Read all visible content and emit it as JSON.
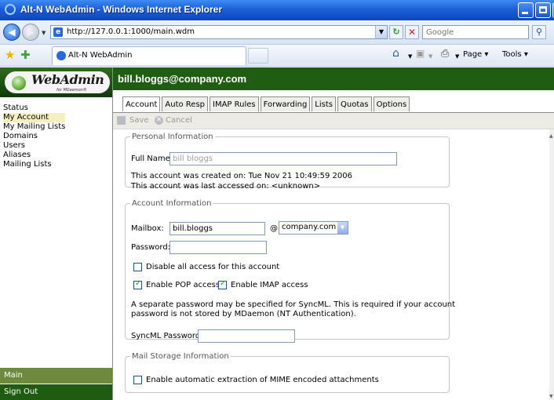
{
  "window": {
    "title": "Alt-N WebAdmin - Windows Internet Explorer"
  },
  "browser": {
    "url": "http://127.0.0.1:1000/main.wdm",
    "search_placeholder": "Google",
    "tab_label": "Alt-N WebAdmin",
    "page_menu": "Page ▾",
    "tools_menu": "Tools ▾"
  },
  "logo": {
    "brand": "WebAdmin",
    "sub": "for MDaemon®"
  },
  "sidebar": {
    "items": [
      "Status",
      "My Account",
      "My Mailing Lists",
      "Domains",
      "Users",
      "Aliases",
      "Mailing Lists"
    ],
    "active_index": 1,
    "main_label": "Main",
    "signout_label": "Sign Out"
  },
  "header": {
    "user": "bill.bloggs@company.com"
  },
  "tabs": [
    "Account",
    "Auto Resp",
    "IMAP Rules",
    "Forwarding",
    "Lists",
    "Quotas",
    "Options"
  ],
  "active_tab": "Account",
  "toolbar": {
    "save": "Save",
    "cancel": "Cancel"
  },
  "personal": {
    "legend": "Personal Information",
    "full_name_label": "Full Name:",
    "full_name_value": "bill bloggs",
    "created_line": "This account was created on: Tue Nov 21 10:49:59 2006",
    "accessed_line": "This account was last accessed on: <unknown>"
  },
  "account": {
    "legend": "Account Information",
    "mailbox_label": "Mailbox:",
    "mailbox_value": "bill.bloggs",
    "at": "@",
    "domain_value": "company.com",
    "password_label": "Password:",
    "password_value": "",
    "disable_label": "Disable all access for this account",
    "disable_checked": false,
    "pop_label": "Enable POP access",
    "pop_checked": true,
    "imap_label": "Enable IMAP access",
    "imap_checked": true,
    "syncml_note_1": "A separate password may be specified for SyncML. This is required if your account",
    "syncml_note_2": "password is not stored by MDaemon (NT Authentication).",
    "syncml_label": "SyncML Password:",
    "syncml_value": ""
  },
  "storage": {
    "legend": "Mail Storage Information",
    "mime_label": "Enable automatic extraction of MIME encoded attachments",
    "mime_checked": false
  }
}
